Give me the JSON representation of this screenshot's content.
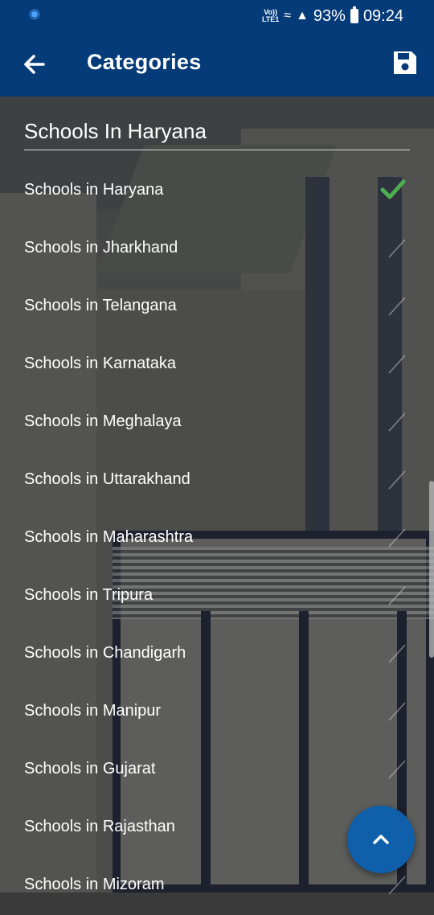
{
  "status_bar": {
    "volte_label": "Vo))\nLTE1",
    "battery_text": "93%",
    "time": "09:24"
  },
  "app_bar": {
    "title": "Categories",
    "back_icon": "arrow-left-icon",
    "save_icon": "save-icon"
  },
  "selected": {
    "value": "Schools In Haryana"
  },
  "categories": [
    {
      "label": "Schools in Haryana",
      "checked": true
    },
    {
      "label": "Schools in Jharkhand",
      "checked": false
    },
    {
      "label": "Schools in Telangana",
      "checked": false
    },
    {
      "label": "Schools in Karnataka",
      "checked": false
    },
    {
      "label": "Schools in Meghalaya",
      "checked": false
    },
    {
      "label": "Schools in Uttarakhand",
      "checked": false
    },
    {
      "label": "Schools in Maharashtra",
      "checked": false
    },
    {
      "label": "Schools in Tripura",
      "checked": false
    },
    {
      "label": "Schools in Chandigarh",
      "checked": false
    },
    {
      "label": "Schools in Manipur",
      "checked": false
    },
    {
      "label": "Schools in Gujarat",
      "checked": false
    },
    {
      "label": "Schools in Rajasthan",
      "checked": false
    },
    {
      "label": "Schools in Mizoram",
      "checked": false
    }
  ],
  "colors": {
    "app_bar": "#053b78",
    "checked": "#4caf50",
    "fab": "#0f5fab"
  }
}
